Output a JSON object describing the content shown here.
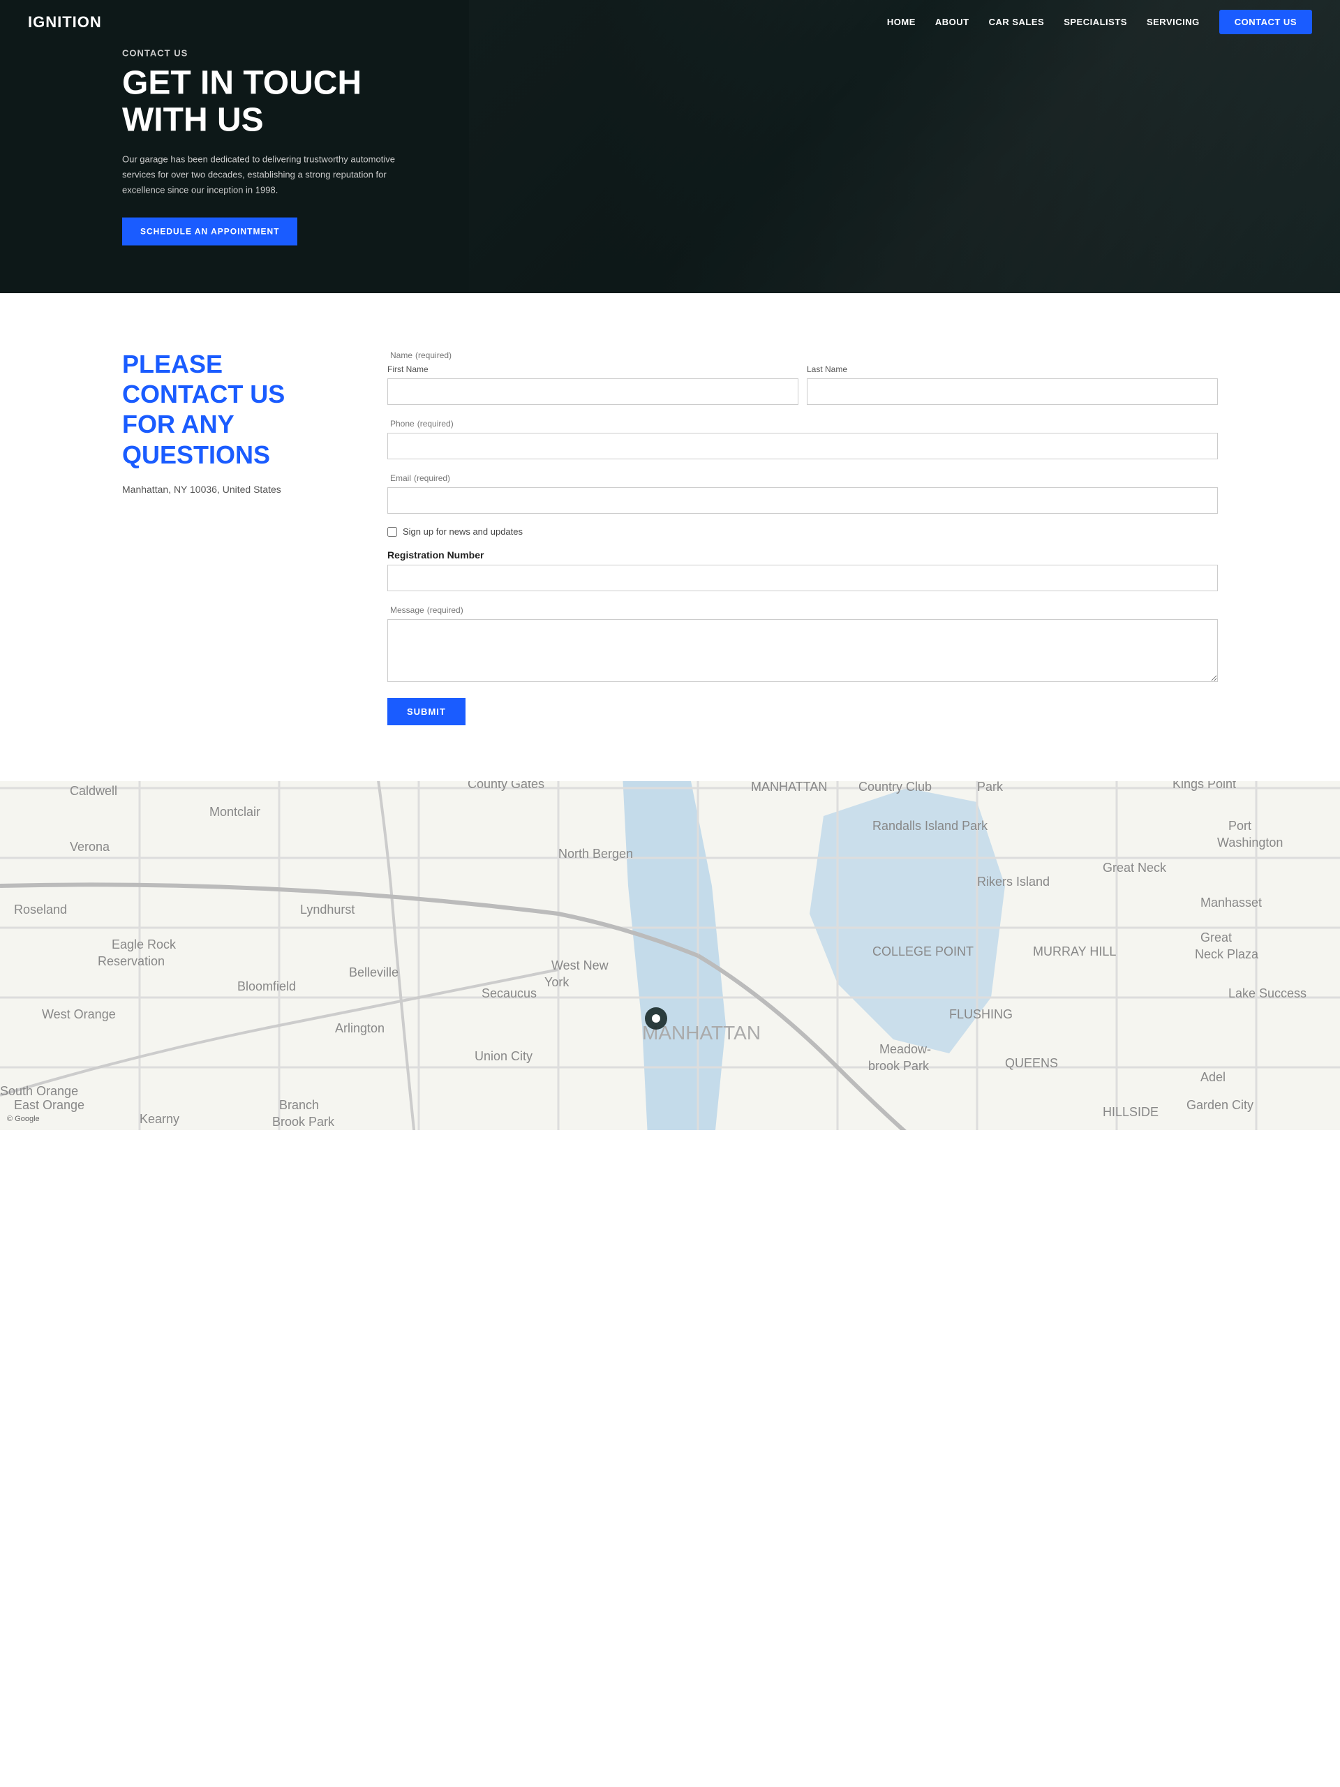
{
  "brand": {
    "logo": "IGNITION"
  },
  "nav": {
    "links": [
      {
        "label": "HOME",
        "href": "#"
      },
      {
        "label": "ABOUT",
        "href": "#"
      },
      {
        "label": "CAR SALES",
        "href": "#"
      },
      {
        "label": "SPECIALISTS",
        "href": "#"
      },
      {
        "label": "SERVICING",
        "href": "#"
      }
    ],
    "contact_button": "CONTACT US"
  },
  "hero": {
    "label": "CONTACT US",
    "title": "GET IN TOUCH WITH US",
    "description": "Our garage has been dedicated to delivering trustworthy automotive services for over two decades, establishing a strong reputation for excellence since our inception in 1998.",
    "cta_button": "SCHEDULE AN APPOINTMENT"
  },
  "contact": {
    "heading": "PLEASE CONTACT US FOR ANY QUESTIONS",
    "address": "Manhattan, NY 10036, United States"
  },
  "form": {
    "name_label": "Name",
    "name_required": "(required)",
    "first_name_label": "First Name",
    "last_name_label": "Last Name",
    "phone_label": "Phone",
    "phone_required": "(required)",
    "email_label": "Email",
    "email_required": "(required)",
    "newsletter_label": "Sign up for news and updates",
    "registration_label": "Registration Number",
    "message_label": "Message",
    "message_required": "(required)",
    "submit_label": "SUBMIT"
  },
  "map": {
    "attribution": "© Google"
  }
}
